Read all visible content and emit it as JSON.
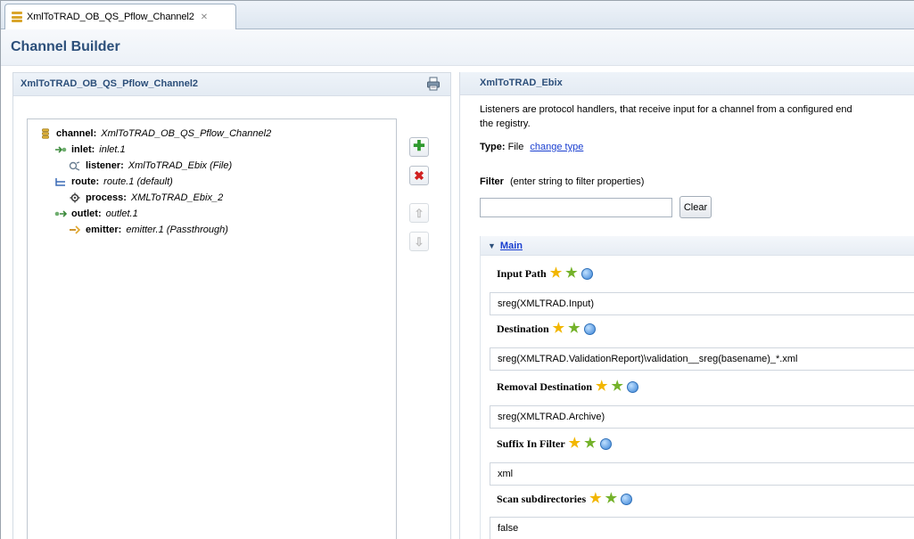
{
  "tab": {
    "title": "XmlToTRAD_OB_QS_Pflow_Channel2",
    "close_glyph": "✕"
  },
  "header": {
    "title": "Channel Builder"
  },
  "left": {
    "title": "XmlToTRAD_OB_QS_Pflow_Channel2",
    "tree": [
      {
        "kind": "channel",
        "key": "channel:",
        "value": "XmlToTRAD_OB_QS_Pflow_Channel2",
        "icon": "channel-icon"
      },
      {
        "kind": "inlet",
        "key": "inlet:",
        "value": "inlet.1",
        "icon": "inlet-icon"
      },
      {
        "kind": "listener",
        "key": "listener:",
        "value": "XmlToTRAD_Ebix (File)",
        "icon": "listener-icon"
      },
      {
        "kind": "route",
        "key": "route:",
        "value": "route.1 (default)",
        "icon": "route-icon"
      },
      {
        "kind": "process",
        "key": "process:",
        "value": "XMLToTRAD_Ebix_2",
        "icon": "process-icon"
      },
      {
        "kind": "outlet",
        "key": "outlet:",
        "value": "outlet.1",
        "icon": "outlet-icon"
      },
      {
        "kind": "emitter",
        "key": "emitter:",
        "value": "emitter.1 (Passthrough)",
        "icon": "emitter-icon"
      }
    ],
    "buttons": {
      "add": "add-icon",
      "delete": "delete-icon",
      "up": "move-up-icon",
      "down": "move-down-icon"
    }
  },
  "right": {
    "title": "XmlToTRAD_Ebix",
    "description_line1": "Listeners are protocol handlers, that receive input for a channel from a configured end",
    "description_line2": "the registry.",
    "type_label": "Type:",
    "type_value": "File",
    "change_type": "change type",
    "filter_label": "Filter",
    "filter_hint": "(enter string to filter properties)",
    "filter_value": "",
    "clear_label": "Clear",
    "section": "Main",
    "properties": [
      {
        "label": "Input Path",
        "value": "sreg(XMLTRAD.Input)"
      },
      {
        "label": "Destination",
        "value": "sreg(XMLTRAD.ValidationReport)\\validation__sreg(basename)_*.xml"
      },
      {
        "label": "Removal Destination",
        "value": "sreg(XMLTRAD.Archive)"
      },
      {
        "label": "Suffix In Filter",
        "value": "xml"
      },
      {
        "label": "Scan subdirectories",
        "value": "false"
      }
    ]
  },
  "colors": {
    "title_blue": "#2c4f7a",
    "link_blue": "#1a3fd0",
    "panel_head": "#e8eef5"
  }
}
